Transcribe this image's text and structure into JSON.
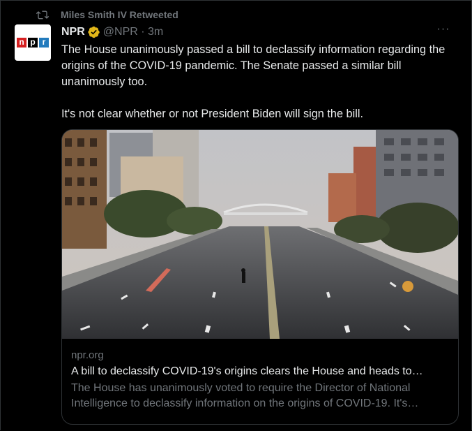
{
  "retweet": {
    "text": "Miles Smith IV Retweeted",
    "icon": "retweet-icon"
  },
  "author": {
    "avatar_letters": [
      "n",
      "p",
      "r"
    ],
    "avatar_colors": [
      "#d62021",
      "#000000",
      "#237bbd"
    ],
    "name": "NPR",
    "verified_icon": "verified-badge-icon",
    "verified_color": "#e2b719",
    "handle_time": "@NPR · 3m"
  },
  "menu": {
    "more_label": "···",
    "icon": "more-icon"
  },
  "tweet": {
    "text": "The House unanimously passed a bill to declassify information regarding the origins of the COVID-19 pandemic. The Senate passed a similar bill unanimously too.\n\nIt's not clear whether or not President Biden will sign the bill."
  },
  "card": {
    "image_alt": "empty street-photo",
    "domain": "npr.org",
    "title": "A bill to declassify COVID-19's origins clears the House and heads to…",
    "description": "The House has unanimously voted to require the Director of National Intelligence to declassify information on the origins of COVID-19. It's…"
  },
  "colors": {
    "background": "#000000",
    "text_primary": "#e7e9ea",
    "text_secondary": "#71767b",
    "border": "#2f3336"
  }
}
